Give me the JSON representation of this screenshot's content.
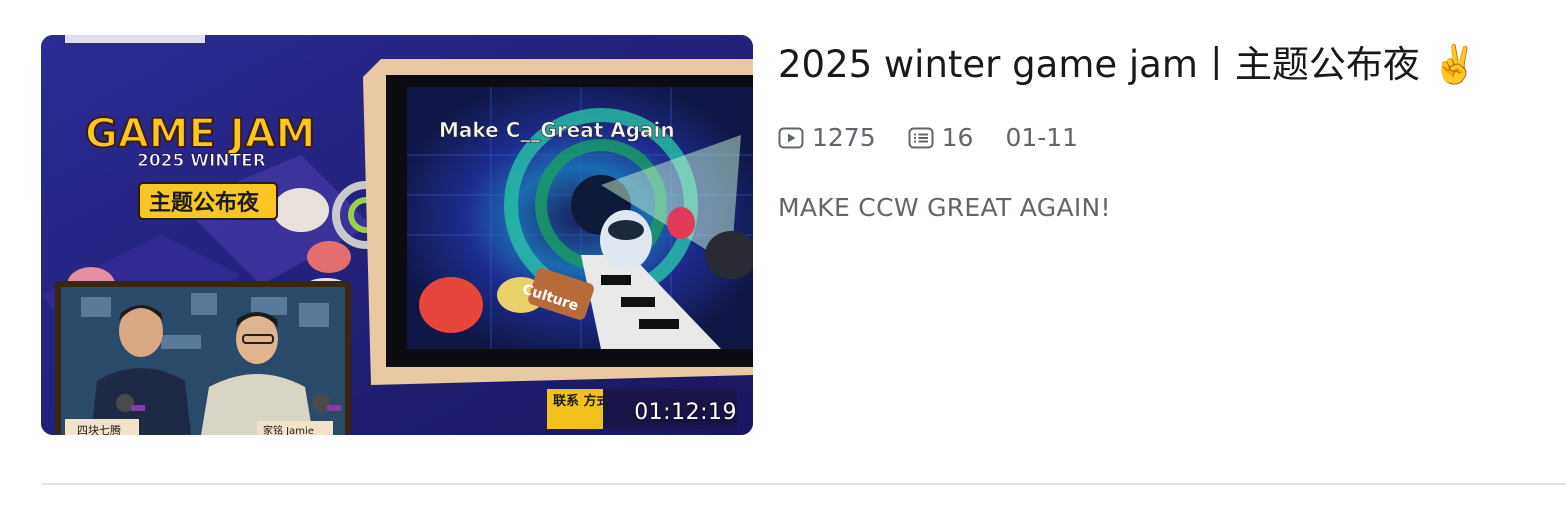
{
  "video": {
    "duration": "01:12:19",
    "title": "2025 winter game jam丨主题公布夜",
    "title_emoji": "✌️",
    "stats": {
      "plays": "1275",
      "comments": "16",
      "date": "01-11"
    },
    "description": "MAKE CCW GREAT AGAIN!",
    "thumbnail_text": {
      "logo_line1": "GAME JAM",
      "logo_line2": "2025 WINTER",
      "subtitle_badge": "主题公布夜",
      "screen_caption": "Make C__Great Again",
      "contact_label": "联系 方式",
      "nameplate_left": "四块七腾",
      "nameplate_right": "家铭 Jamie"
    }
  },
  "colors": {
    "title": "#18191c",
    "meta": "#61666d",
    "divider": "#e3e5e7",
    "logo_yellow": "#f9c623"
  }
}
